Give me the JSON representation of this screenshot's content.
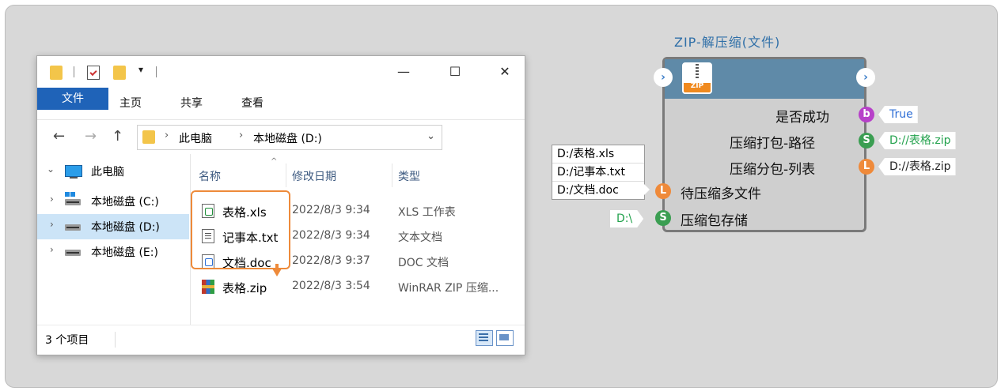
{
  "explorer": {
    "quick_access_dropdown": "▾",
    "window_buttons": {
      "minimize": "—",
      "maximize": "☐",
      "close": "✕"
    },
    "tabs": [
      "文件",
      "主页",
      "共享",
      "查看"
    ],
    "nav": {
      "back": "←",
      "forward": "→",
      "up": "↑"
    },
    "breadcrumb": [
      "此电脑",
      "本地磁盘 (D:)"
    ],
    "breadcrumb_sep": "›",
    "address_dropdown": "⌄",
    "tree": [
      {
        "arrow": "⌄",
        "label": "此电脑"
      },
      {
        "arrow": "›",
        "label": "本地磁盘 (C:)"
      },
      {
        "arrow": "›",
        "label": "本地磁盘 (D:)",
        "selected": true
      },
      {
        "arrow": "›",
        "label": "本地磁盘 (E:)"
      }
    ],
    "columns": [
      "名称",
      "修改日期",
      "类型"
    ],
    "sort_indicator": "^",
    "files": [
      {
        "name": "表格.xls",
        "date": "2022/8/3 9:34",
        "type": "XLS 工作表",
        "icon": "xls-file-icon"
      },
      {
        "name": "记事本.txt",
        "date": "2022/8/3 9:34",
        "type": "文本文档",
        "icon": "txt-file-icon"
      },
      {
        "name": "文档.doc",
        "date": "2022/8/3 9:37",
        "type": "DOC 文档",
        "icon": "doc-file-icon"
      },
      {
        "name": "表格.zip",
        "date": "2022/8/3 3:54",
        "type": "WinRAR ZIP 压缩...",
        "icon": "zip-file-icon"
      }
    ],
    "status": "3 个项目"
  },
  "node": {
    "title": "ZIP-解压缩(文件)",
    "zip_icon_label": "ZIP",
    "exec_arrow": "›",
    "outputs": [
      {
        "label": "是否成功",
        "pin": "b",
        "value": "True",
        "value_color": "#2f6fd6"
      },
      {
        "label": "压缩打包-路径",
        "pin": "S",
        "value": "D://表格.zip",
        "value_color": "#23a24d"
      },
      {
        "label": "压缩分包-列表",
        "pin": "L",
        "value": "D://表格.zip",
        "value_color": "#222222"
      }
    ],
    "inputs": [
      {
        "label": "待压缩多文件",
        "pin": "L"
      },
      {
        "label": "压缩包存储",
        "pin": "S",
        "value": "D:\\",
        "value_color": "#23a24d"
      }
    ],
    "input_list": [
      "D:/表格.xls",
      "D:/记事本.txt",
      "D:/文档.doc"
    ]
  },
  "colors": {
    "accent_tab": "#1f63b8",
    "selection_outline": "#ee8a3a",
    "node_header": "#5f8aa8",
    "pin_bool": "#b740c9",
    "pin_string": "#3b9e52",
    "pin_list": "#ef8a3a"
  }
}
